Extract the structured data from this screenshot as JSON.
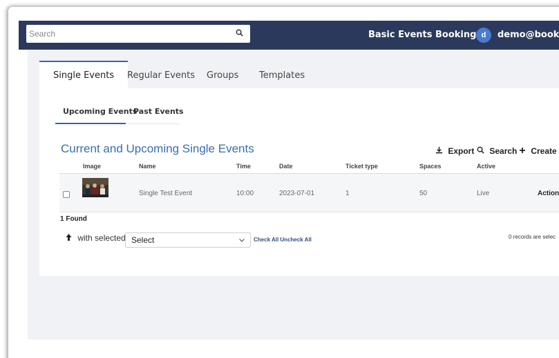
{
  "header": {
    "search_placeholder": "Search",
    "search_icon": "magnifier-icon",
    "site_menu": "Basic Events Bookings ▾",
    "avatar_letter": "d",
    "user_email": "demo@booking"
  },
  "main_tabs": [
    "Single Events",
    "Regular Events",
    "Groups",
    "Templates"
  ],
  "sub_tabs": [
    "Upcoming Events",
    "Past Events"
  ],
  "section": {
    "title": "Current and Upcoming Single Events",
    "export_label": "Export",
    "search_label": "Search",
    "create_label": "Create Ne"
  },
  "table": {
    "columns": [
      "Image",
      "Name",
      "Time",
      "Date",
      "Ticket type",
      "Spaces",
      "Active"
    ],
    "rows": [
      {
        "name": "Single Test Event",
        "time": "10:00",
        "date": "2023-07-01",
        "ticket_type": "1",
        "spaces": "50",
        "active": "Live",
        "actions": "Actions"
      }
    ]
  },
  "footer": {
    "found": "1 Found",
    "with_selected": "with selected",
    "select_value": "Select",
    "check_all": "Check All",
    "uncheck_all": "Uncheck All",
    "records_selected": "0 records are selec"
  },
  "colors": {
    "topbar": "#2b3a5c",
    "accent": "#2f63a8",
    "title": "#3a6db0"
  }
}
